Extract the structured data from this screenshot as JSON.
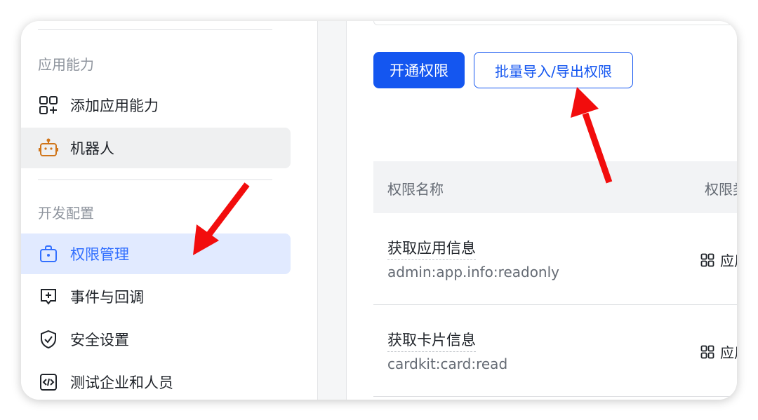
{
  "sidebar": {
    "section_app_ability": "应用能力",
    "add_ability": "添加应用能力",
    "robot": "机器人",
    "section_dev_config": "开发配置",
    "permission_mgmt": "权限管理",
    "events_callbacks": "事件与回调",
    "security_settings": "安全设置",
    "test_company_people": "测试企业和人员"
  },
  "toolbar": {
    "enable_permission": "开通权限",
    "batch_import_export": "批量导入/导出权限"
  },
  "table": {
    "columns": [
      "权限名称",
      "权限类"
    ],
    "rows": [
      {
        "name": "获取应用信息",
        "code": "admin:app.info:readonly",
        "type": "应用"
      },
      {
        "name": "获取卡片信息",
        "code": "cardkit:card:read",
        "type": "应用"
      }
    ]
  },
  "colors": {
    "primary": "#1456f0",
    "active_bg": "#e1eaff",
    "annotation_arrow": "#f20d0d"
  }
}
